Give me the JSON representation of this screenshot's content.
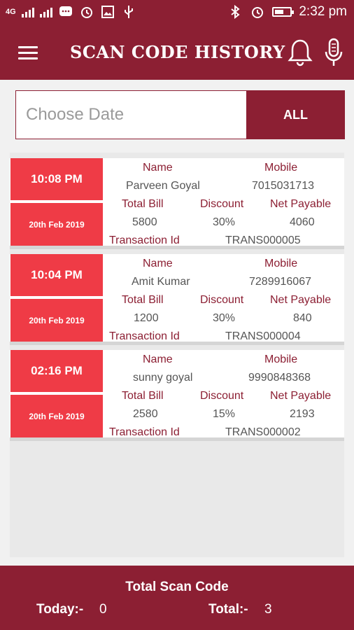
{
  "status_bar": {
    "network": "4G",
    "time": "2:32 pm",
    "icons": [
      "signal-icon",
      "signal-icon",
      "whatsapp-icon",
      "alarm-icon",
      "image-icon",
      "usb-icon",
      "bluetooth-icon",
      "alarm-icon",
      "battery-icon"
    ]
  },
  "header": {
    "title": "SCAN CODE HISTORY",
    "icons": [
      "menu-icon",
      "bell-icon",
      "mic-icon"
    ]
  },
  "filter": {
    "date_placeholder": "Choose Date",
    "all_label": "ALL"
  },
  "labels": {
    "name": "Name",
    "mobile": "Mobile",
    "total_bill": "Total Bill",
    "discount": "Discount",
    "net_payable": "Net Payable",
    "transaction_id": "Transaction Id"
  },
  "records": [
    {
      "time": "10:08 PM",
      "date": "20th Feb 2019",
      "name": "Parveen Goyal",
      "mobile": "7015031713",
      "total_bill": "5800",
      "discount": "30%",
      "net_payable": "4060",
      "transaction_id": "TRANS000005"
    },
    {
      "time": "10:04 PM",
      "date": "20th Feb 2019",
      "name": "Amit Kumar",
      "mobile": "7289916067",
      "total_bill": "1200",
      "discount": "30%",
      "net_payable": "840",
      "transaction_id": "TRANS000004"
    },
    {
      "time": "02:16 PM",
      "date": "20th Feb 2019",
      "name": "sunny goyal",
      "mobile": "9990848368",
      "total_bill": "2580",
      "discount": "15%",
      "net_payable": "2193",
      "transaction_id": "TRANS000002"
    }
  ],
  "footer": {
    "title": "Total Scan Code",
    "today_label": "Today:-",
    "today_value": "0",
    "total_label": "Total:-",
    "total_value": "3"
  },
  "colors": {
    "primary": "#8c1f33",
    "accent": "#ef3b46",
    "background": "#f1f1f1"
  }
}
